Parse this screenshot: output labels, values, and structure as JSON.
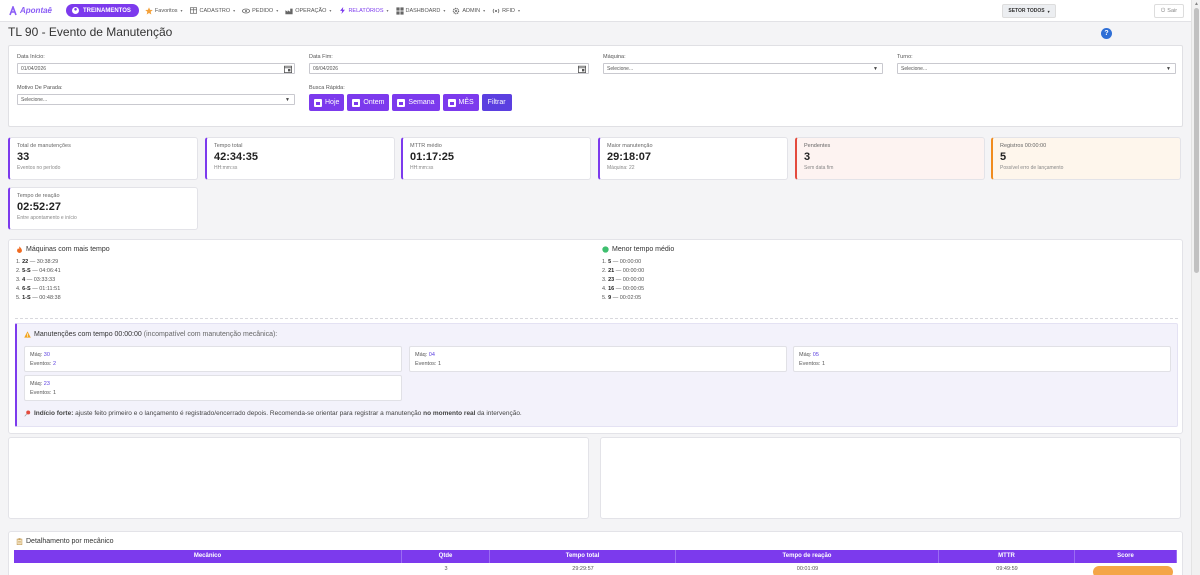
{
  "nav": {
    "brand": "Apontaê",
    "treinamentos": "TREINAMENTOS",
    "items": [
      {
        "label": "Favoritos",
        "icon": "star-icon"
      },
      {
        "label": "CADASTRO",
        "icon": "grid-icon"
      },
      {
        "label": "PEDIDO",
        "icon": "eye-icon"
      },
      {
        "label": "OPERAÇÃO",
        "icon": "factory-icon"
      },
      {
        "label": "RELATÓRIOS",
        "icon": "bolt-icon"
      },
      {
        "label": "DASHBOARD",
        "icon": "dashboard-icon"
      },
      {
        "label": "ADMIN",
        "icon": "gear-icon"
      },
      {
        "label": "RFID",
        "icon": "rfid-icon"
      }
    ],
    "setor": "SETOR TODOS",
    "sair": "Sair"
  },
  "page": {
    "title": "TL 90 - Evento de Manutenção"
  },
  "filters": {
    "data_inicio": {
      "label": "Data Início:",
      "value": "01/04/2026"
    },
    "data_fim": {
      "label": "Data Fim:",
      "value": "09/04/2026"
    },
    "maquina": {
      "label": "Máquina:",
      "value": "Selecione..."
    },
    "turno": {
      "label": "Turno:",
      "value": "Selecione..."
    },
    "motivo": {
      "label": "Motivo De Parada:",
      "value": "Selecione..."
    },
    "busca_rapida": {
      "label": "Busca Rápida:"
    },
    "quick": {
      "hoje": "Hoje",
      "ontem": "Ontem",
      "semana": "Semana",
      "mes": "MÊS",
      "filtrar": "Filtrar"
    }
  },
  "kpis": [
    {
      "label": "Total de manutenções",
      "value": "33",
      "sub": "Eventos no período"
    },
    {
      "label": "Tempo total",
      "value": "42:34:35",
      "sub": "HH:mm:ss"
    },
    {
      "label": "MTTR médio",
      "value": "01:17:25",
      "sub": "HH:mm:ss"
    },
    {
      "label": "Maior manutenção",
      "value": "29:18:07",
      "sub": "Máquina: 22"
    },
    {
      "label": "Pendentes",
      "value": "3",
      "sub": "Sem data fim"
    },
    {
      "label": "Registros 00:00:00",
      "value": "5",
      "sub": "Possível erro de lançamento"
    },
    {
      "label": "Tempo de reação",
      "value": "02:52:27",
      "sub": "Entre apontamento e início"
    }
  ],
  "rank_mais": {
    "title": "Máquinas com mais tempo",
    "rows": [
      {
        "pos": "1.",
        "maq": "22",
        "time": "— 30:38:29"
      },
      {
        "pos": "2.",
        "maq": "5-S",
        "time": "— 04:06:41"
      },
      {
        "pos": "3.",
        "maq": "4",
        "time": "— 03:33:33"
      },
      {
        "pos": "4.",
        "maq": "6-S",
        "time": "— 01:11:51"
      },
      {
        "pos": "5.",
        "maq": "1-S",
        "time": "— 00:48:38"
      }
    ]
  },
  "rank_menor": {
    "title": "Menor tempo médio",
    "rows": [
      {
        "pos": "1.",
        "maq": "5",
        "time": "— 00:00:00"
      },
      {
        "pos": "2.",
        "maq": "21",
        "time": "— 00:00:00"
      },
      {
        "pos": "3.",
        "maq": "23",
        "time": "— 00:00:00"
      },
      {
        "pos": "4.",
        "maq": "16",
        "time": "— 00:00:05"
      },
      {
        "pos": "5.",
        "maq": "9",
        "time": "— 00:02:05"
      }
    ]
  },
  "warning": {
    "title": "Manutenções com tempo 00:00:00",
    "note": "(incompatível com manutenção mecânica):",
    "maq_label": "Máq:",
    "eventos_label": "Eventos:",
    "machines": [
      {
        "maq": "30",
        "eventos": "2"
      },
      {
        "maq": "04",
        "eventos": "1"
      },
      {
        "maq": "05",
        "eventos": "1"
      },
      {
        "maq": "23",
        "eventos": "1"
      }
    ],
    "indicio_bold": "Indício forte:",
    "indicio_text": " ajuste feito primeiro e o lançamento é registrado/encerrado depois. Recomenda-se orientar para registrar a manutenção ",
    "indicio_bold2": "no momento real",
    "indicio_end": " da intervenção."
  },
  "mechanic": {
    "title": "Detalhamento por mecânico",
    "headers": [
      "Mecânico",
      "Qtde",
      "Tempo total",
      "Tempo de reação",
      "MTTR",
      "Score"
    ],
    "row": [
      "",
      "3",
      "29:29:57",
      "00:01:09",
      "09:49:59",
      ""
    ]
  },
  "colors": {
    "accent": "#7c3aed",
    "danger": "#e34a3d",
    "warning": "#f08c1f",
    "help": "#2f6fd6"
  }
}
